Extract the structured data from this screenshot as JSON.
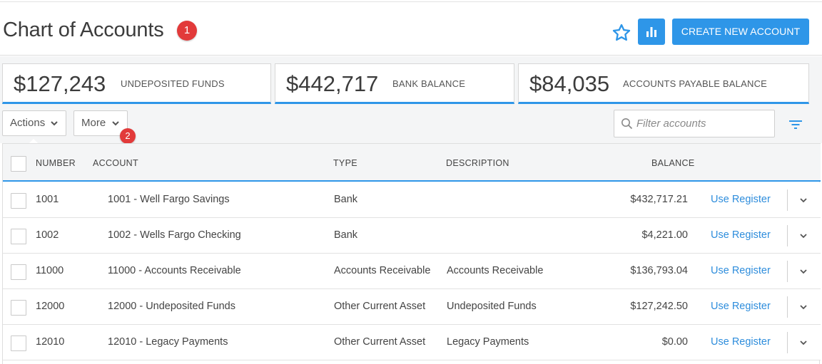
{
  "header": {
    "title": "Chart of Accounts",
    "badge_1": "1",
    "create_button": "CREATE NEW ACCOUNT",
    "icons": [
      "star-icon",
      "bar-chart-icon"
    ]
  },
  "summary": {
    "cards": [
      {
        "value": "$127,243",
        "label": "UNDEPOSITED FUNDS"
      },
      {
        "value": "$442,717",
        "label": "BANK BALANCE"
      },
      {
        "value": "$84,035",
        "label": "ACCOUNTS PAYABLE BALANCE"
      }
    ]
  },
  "toolbar": {
    "actions_label": "Actions",
    "more_label": "More",
    "badge_2": "2",
    "filter_placeholder": "Filter accounts"
  },
  "table": {
    "columns": [
      "NUMBER",
      "ACCOUNT",
      "TYPE",
      "DESCRIPTION",
      "BALANCE"
    ],
    "rows": [
      {
        "number": "1001",
        "account": "1001 - Well Fargo Savings",
        "type": "Bank",
        "description": "",
        "balance": "$432,717.21",
        "action": "Use Register"
      },
      {
        "number": "1002",
        "account": "1002 - Wells Fargo Checking",
        "type": "Bank",
        "description": "",
        "balance": "$4,221.00",
        "action": "Use Register"
      },
      {
        "number": "11000",
        "account": "11000 - Accounts Receivable",
        "type": "Accounts Receivable",
        "description": "Accounts Receivable",
        "balance": "$136,793.04",
        "action": "Use Register"
      },
      {
        "number": "12000",
        "account": "12000 - Undeposited Funds",
        "type": "Other Current Asset",
        "description": "Undeposited Funds",
        "balance": "$127,242.50",
        "action": "Use Register"
      },
      {
        "number": "12010",
        "account": "12010 - Legacy Payments",
        "type": "Other Current Asset",
        "description": "Legacy Payments",
        "balance": "$0.00",
        "action": "Use Register"
      }
    ]
  },
  "colors": {
    "accent": "#2e96e8",
    "badge": "#e23a3a",
    "link": "#2e8ddc"
  }
}
